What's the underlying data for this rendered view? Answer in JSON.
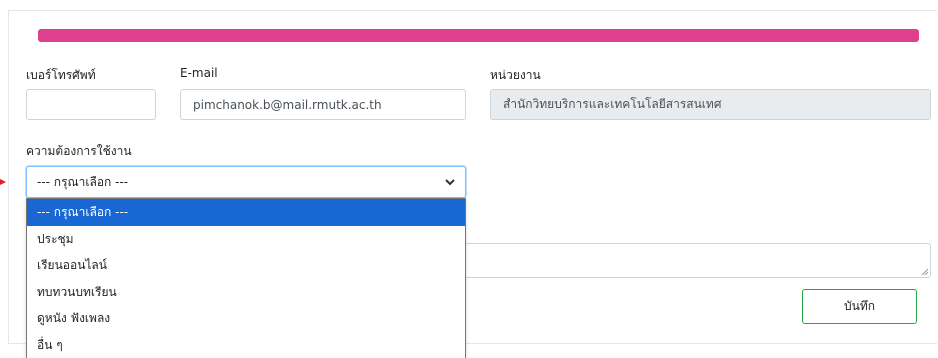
{
  "form": {
    "phone": {
      "label": "เบอร์โทรศัพท์",
      "value": ""
    },
    "email": {
      "label": "E-mail",
      "value": "pimchanok.b@mail.rmutk.ac.th"
    },
    "department": {
      "label": "หน่วยงาน",
      "value": "สำนักวิทยบริการและเทคโนโลยีสารสนเทศ"
    },
    "requirement": {
      "label": "ความต้องการใช้งาน",
      "selected": "--- กรุณาเลือก ---",
      "options": [
        "--- กรุณาเลือก ---",
        "ประชุม",
        "เรียนออนไลน์",
        "ทบทวนบทเรียน",
        "ดูหนัง ฟังเพลง",
        "อื่น ๆ"
      ]
    },
    "notes": {
      "value": ""
    },
    "save_label": "บันทึก"
  },
  "colors": {
    "accent_bar": "#e03f8d",
    "save_border": "#28a745",
    "option_highlight": "#1967d2",
    "focus_border": "#80bdff"
  },
  "icons": {
    "select_chevron": "chevron-down-icon",
    "textarea_resize": "resize-grip-icon",
    "pointer": "red-arrow-icon"
  }
}
